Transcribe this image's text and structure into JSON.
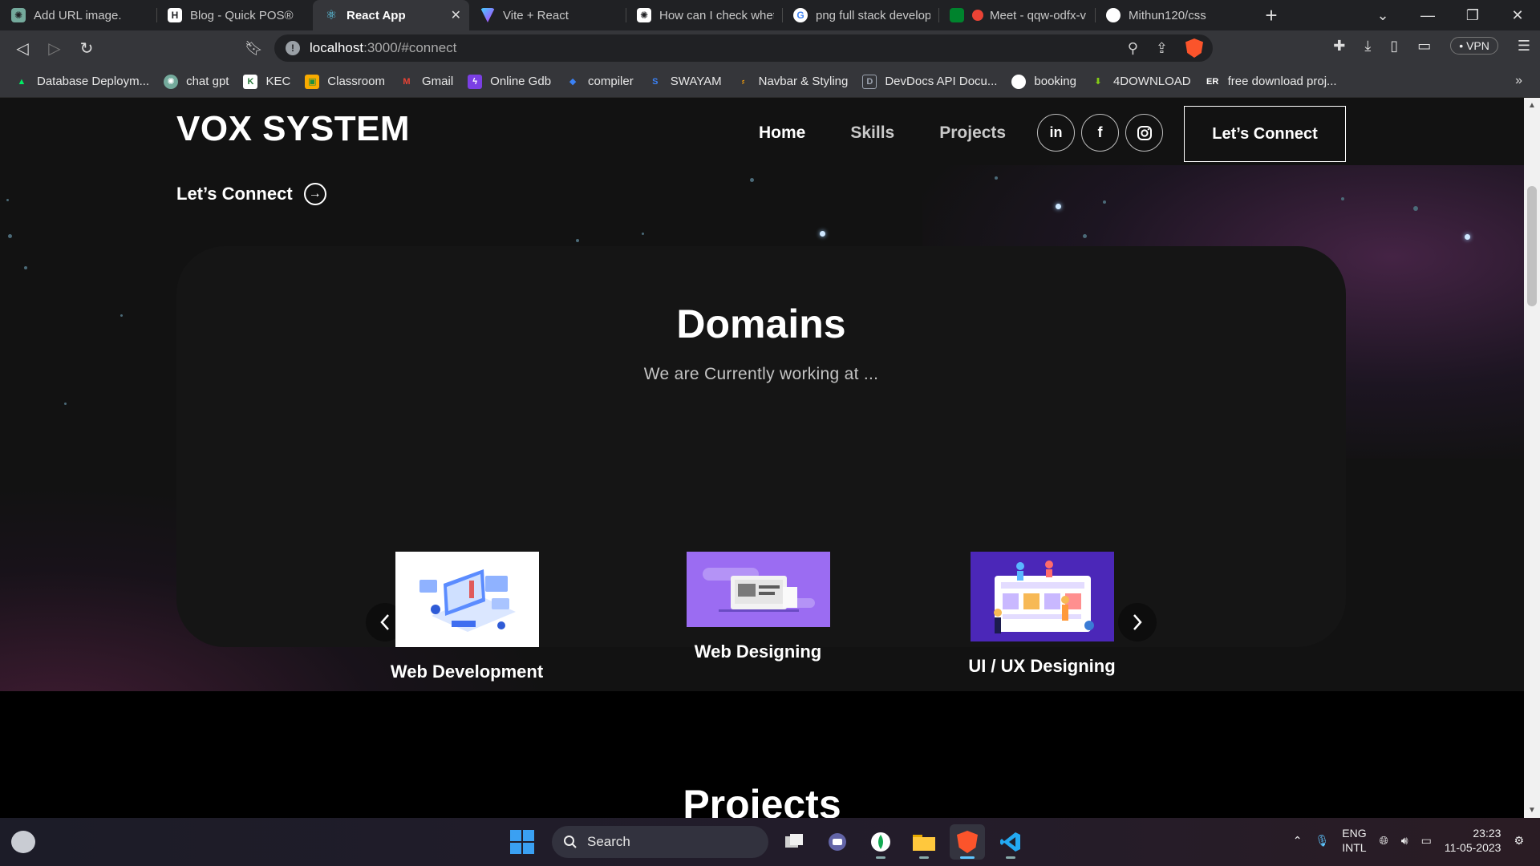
{
  "browser": {
    "tabs": [
      {
        "label": "Add URL image.",
        "icon": "openai-icon",
        "color": "#74aa9c",
        "active": false
      },
      {
        "label": "Blog - Quick POS®",
        "icon": "h-letter-icon",
        "color": "#ffffff",
        "active": false
      },
      {
        "label": "React App",
        "icon": "react-icon",
        "color": "#61dafb",
        "active": true
      },
      {
        "label": "Vite + React",
        "icon": "vite-icon",
        "color": "#a855f7",
        "active": false
      },
      {
        "label": "How can I check wheth",
        "icon": "openai-icon",
        "color": "#ffffff",
        "active": false
      },
      {
        "label": "png full stack develope",
        "icon": "google-icon",
        "color": "#4285f4",
        "active": false
      },
      {
        "label": "Meet - qqw-odfx-v",
        "icon": "meet-icon",
        "color": "#ea4335",
        "active": false
      },
      {
        "label": "Mithun120/css",
        "icon": "github-icon",
        "color": "#ffffff",
        "active": false
      }
    ],
    "new_tab": "+",
    "url_host": "localhost",
    "url_rest": ":3000/#connect",
    "vpn_label": "• VPN",
    "bookmarks": [
      {
        "label": "Database Deploym...",
        "icon": "mongodb-icon",
        "color": "#00ed64"
      },
      {
        "label": "chat gpt",
        "icon": "openai-icon",
        "color": "#74aa9c"
      },
      {
        "label": "KEC",
        "icon": "kec-icon",
        "color": "#2a7a3b"
      },
      {
        "label": "Classroom",
        "icon": "classroom-icon",
        "color": "#f9ab00"
      },
      {
        "label": "Gmail",
        "icon": "gmail-icon",
        "color": "#ea4335"
      },
      {
        "label": "Online Gdb",
        "icon": "gdb-icon",
        "color": "#7b3fe4"
      },
      {
        "label": "compiler",
        "icon": "compiler-icon",
        "color": "#3b82f6"
      },
      {
        "label": "SWAYAM",
        "icon": "swayam-icon",
        "color": "#2563eb"
      },
      {
        "label": "Navbar & Styling",
        "icon": "navbar-icon",
        "color": "#f59e0b"
      },
      {
        "label": "DevDocs API Docu...",
        "icon": "devdocs-icon",
        "color": "#9ca3af"
      },
      {
        "label": "booking",
        "icon": "github-icon",
        "color": "#ffffff"
      },
      {
        "label": "4DOWNLOAD",
        "icon": "download-arrow-icon",
        "color": "#84cc16"
      },
      {
        "label": "free download proj...",
        "icon": "er-icon",
        "color": "#ffffff"
      }
    ],
    "more": "»"
  },
  "page": {
    "brand": "VOX SYSTEM",
    "nav": [
      {
        "label": "Home"
      },
      {
        "label": "Skills"
      },
      {
        "label": "Projects"
      }
    ],
    "socials": [
      {
        "glyph": "in",
        "icon": "linkedin-icon"
      },
      {
        "glyph": "f",
        "icon": "facebook-icon"
      },
      {
        "glyph": "◎",
        "icon": "instagram-icon"
      }
    ],
    "connect_button": "Let’s Connect",
    "hero_link": "Let’s Connect",
    "domains": {
      "title": "Domains",
      "subtitle": "We are Currently working at ...",
      "items": [
        {
          "label": "Web Development"
        },
        {
          "label": "Web Designing"
        },
        {
          "label": "UI / UX Designing"
        }
      ]
    },
    "projects_title": "Projects"
  },
  "taskbar": {
    "search_placeholder": "Search",
    "lang_line1": "ENG",
    "lang_line2": "INTL",
    "time": "23:23",
    "date": "11-05-2023"
  },
  "colors": {
    "accent_purple": "#9b6cf2",
    "uiux_bg": "#4b27b8",
    "page_bg": "#121212",
    "card_bg": "#151515"
  }
}
